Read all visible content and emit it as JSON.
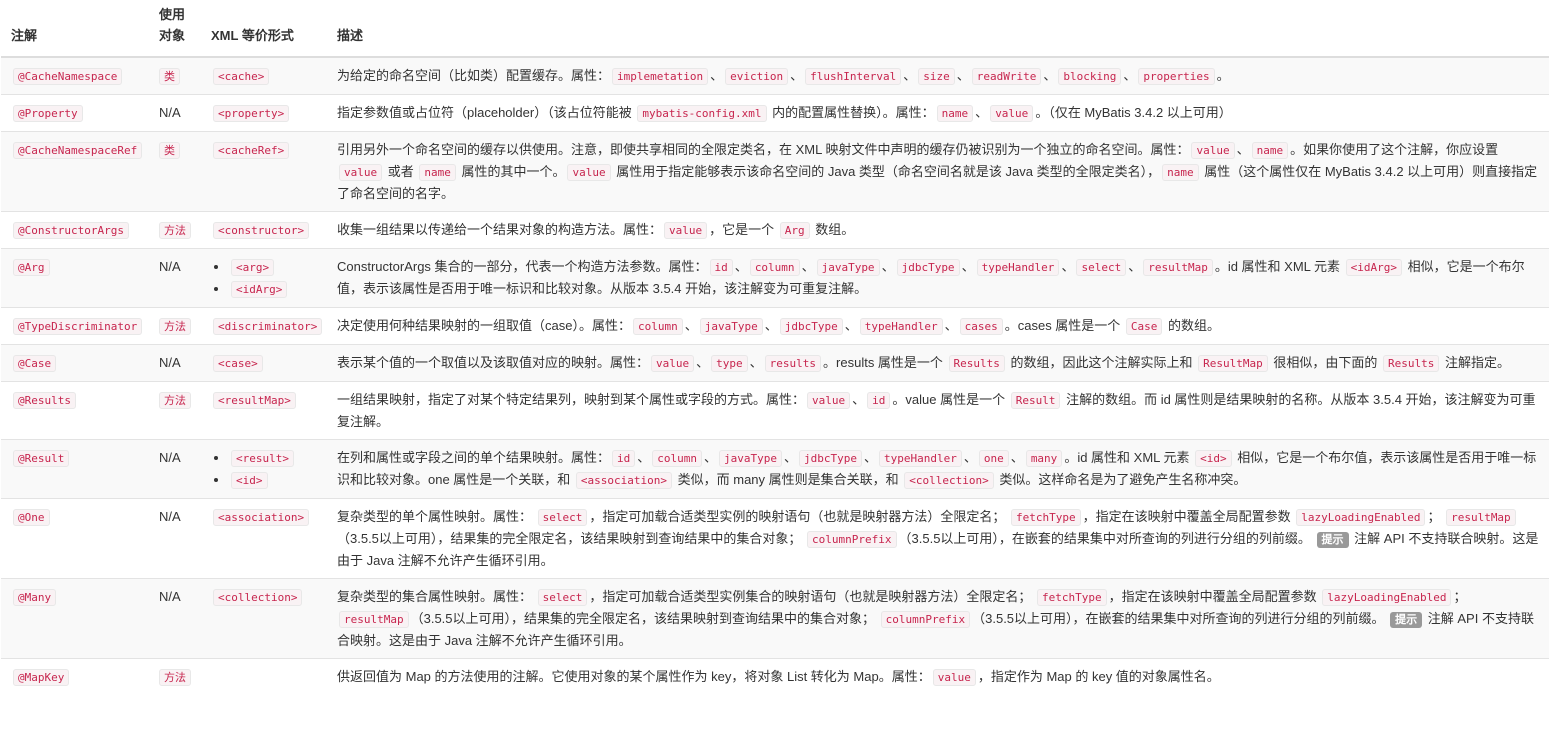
{
  "header": {
    "annotation": "注解",
    "target": "使用\n对象",
    "xml": "XML 等价形式",
    "desc": "描述"
  },
  "rows": [
    {
      "annotation": "@CacheNamespace",
      "target": "类",
      "target_code": true,
      "xml": [
        "<cache>"
      ],
      "desc": [
        [
          "t",
          "为给定的命名空间（比如类）配置缓存。属性："
        ],
        [
          "c",
          "implemetation"
        ],
        [
          "t",
          "、"
        ],
        [
          "c",
          "eviction"
        ],
        [
          "t",
          "、"
        ],
        [
          "c",
          "flushInterval"
        ],
        [
          "t",
          "、"
        ],
        [
          "c",
          "size"
        ],
        [
          "t",
          "、"
        ],
        [
          "c",
          "readWrite"
        ],
        [
          "t",
          "、"
        ],
        [
          "c",
          "blocking"
        ],
        [
          "t",
          "、"
        ],
        [
          "c",
          "properties"
        ],
        [
          "t",
          "。"
        ]
      ]
    },
    {
      "annotation": "@Property",
      "target": "N/A",
      "target_code": false,
      "xml": [
        "<property>"
      ],
      "desc": [
        [
          "t",
          "指定参数值或占位符（placeholder）（该占位符能被 "
        ],
        [
          "c",
          "mybatis-config.xml"
        ],
        [
          "t",
          " 内的配置属性替换）。属性："
        ],
        [
          "c",
          "name"
        ],
        [
          "t",
          "、"
        ],
        [
          "c",
          "value"
        ],
        [
          "t",
          "。（仅在 MyBatis 3.4.2 以上可用）"
        ]
      ]
    },
    {
      "annotation": "@CacheNamespaceRef",
      "target": "类",
      "target_code": true,
      "xml": [
        "<cacheRef>"
      ],
      "desc": [
        [
          "t",
          "引用另外一个命名空间的缓存以供使用。注意，即使共享相同的全限定类名，在 XML 映射文件中声明的缓存仍被识别为一个独立的命名空间。属性："
        ],
        [
          "c",
          "value"
        ],
        [
          "t",
          "、"
        ],
        [
          "c",
          "name"
        ],
        [
          "t",
          "。如果你使用了这个注解，你应设置 "
        ],
        [
          "c",
          "value"
        ],
        [
          "t",
          " 或者 "
        ],
        [
          "c",
          "name"
        ],
        [
          "t",
          " 属性的其中一个。"
        ],
        [
          "c",
          "value"
        ],
        [
          "t",
          " 属性用于指定能够表示该命名空间的 Java 类型（命名空间名就是该 Java 类型的全限定类名），"
        ],
        [
          "c",
          "name"
        ],
        [
          "t",
          " 属性（这个属性仅在 MyBatis 3.4.2 以上可用）则直接指定了命名空间的名字。"
        ]
      ]
    },
    {
      "annotation": "@ConstructorArgs",
      "target": "方法",
      "target_code": true,
      "xml": [
        "<constructor>"
      ],
      "desc": [
        [
          "t",
          "收集一组结果以传递给一个结果对象的构造方法。属性："
        ],
        [
          "c",
          "value"
        ],
        [
          "t",
          "，它是一个 "
        ],
        [
          "c",
          "Arg"
        ],
        [
          "t",
          " 数组。"
        ]
      ]
    },
    {
      "annotation": "@Arg",
      "target": "N/A",
      "target_code": false,
      "xml_list": true,
      "xml": [
        "<arg>",
        "<idArg>"
      ],
      "desc": [
        [
          "t",
          "ConstructorArgs 集合的一部分，代表一个构造方法参数。属性："
        ],
        [
          "c",
          "id"
        ],
        [
          "t",
          "、"
        ],
        [
          "c",
          "column"
        ],
        [
          "t",
          "、"
        ],
        [
          "c",
          "javaType"
        ],
        [
          "t",
          "、"
        ],
        [
          "c",
          "jdbcType"
        ],
        [
          "t",
          "、"
        ],
        [
          "c",
          "typeHandler"
        ],
        [
          "t",
          "、"
        ],
        [
          "c",
          "select"
        ],
        [
          "t",
          "、"
        ],
        [
          "c",
          "resultMap"
        ],
        [
          "t",
          "。id 属性和 XML 元素 "
        ],
        [
          "c",
          "<idArg>"
        ],
        [
          "t",
          " 相似，它是一个布尔值，表示该属性是否用于唯一标识和比较对象。从版本 3.5.4 开始，该注解变为可重复注解。"
        ]
      ]
    },
    {
      "annotation": "@TypeDiscriminator",
      "target": "方法",
      "target_code": true,
      "xml": [
        "<discriminator>"
      ],
      "desc": [
        [
          "t",
          "决定使用何种结果映射的一组取值（case）。属性："
        ],
        [
          "c",
          "column"
        ],
        [
          "t",
          "、"
        ],
        [
          "c",
          "javaType"
        ],
        [
          "t",
          "、"
        ],
        [
          "c",
          "jdbcType"
        ],
        [
          "t",
          "、"
        ],
        [
          "c",
          "typeHandler"
        ],
        [
          "t",
          "、"
        ],
        [
          "c",
          "cases"
        ],
        [
          "t",
          "。cases 属性是一个 "
        ],
        [
          "c",
          "Case"
        ],
        [
          "t",
          " 的数组。"
        ]
      ]
    },
    {
      "annotation": "@Case",
      "target": "N/A",
      "target_code": false,
      "xml": [
        "<case>"
      ],
      "desc": [
        [
          "t",
          "表示某个值的一个取值以及该取值对应的映射。属性："
        ],
        [
          "c",
          "value"
        ],
        [
          "t",
          "、"
        ],
        [
          "c",
          "type"
        ],
        [
          "t",
          "、"
        ],
        [
          "c",
          "results"
        ],
        [
          "t",
          "。results 属性是一个 "
        ],
        [
          "c",
          "Results"
        ],
        [
          "t",
          " 的数组，因此这个注解实际上和 "
        ],
        [
          "c",
          "ResultMap"
        ],
        [
          "t",
          " 很相似，由下面的 "
        ],
        [
          "c",
          "Results"
        ],
        [
          "t",
          " 注解指定。"
        ]
      ]
    },
    {
      "annotation": "@Results",
      "target": "方法",
      "target_code": true,
      "xml": [
        "<resultMap>"
      ],
      "desc": [
        [
          "t",
          "一组结果映射，指定了对某个特定结果列，映射到某个属性或字段的方式。属性："
        ],
        [
          "c",
          "value"
        ],
        [
          "t",
          "、"
        ],
        [
          "c",
          "id"
        ],
        [
          "t",
          "。value 属性是一个 "
        ],
        [
          "c",
          "Result"
        ],
        [
          "t",
          " 注解的数组。而 id 属性则是结果映射的名称。从版本 3.5.4 开始，该注解变为可重复注解。"
        ]
      ]
    },
    {
      "annotation": "@Result",
      "target": "N/A",
      "target_code": false,
      "xml_list": true,
      "xml": [
        "<result>",
        "<id>"
      ],
      "desc": [
        [
          "t",
          "在列和属性或字段之间的单个结果映射。属性："
        ],
        [
          "c",
          "id"
        ],
        [
          "t",
          "、"
        ],
        [
          "c",
          "column"
        ],
        [
          "t",
          "、"
        ],
        [
          "c",
          "javaType"
        ],
        [
          "t",
          "、"
        ],
        [
          "c",
          "jdbcType"
        ],
        [
          "t",
          "、"
        ],
        [
          "c",
          "typeHandler"
        ],
        [
          "t",
          "、"
        ],
        [
          "c",
          "one"
        ],
        [
          "t",
          "、"
        ],
        [
          "c",
          "many"
        ],
        [
          "t",
          "。id 属性和 XML 元素 "
        ],
        [
          "c",
          "<id>"
        ],
        [
          "t",
          " 相似，它是一个布尔值，表示该属性是否用于唯一标识和比较对象。one 属性是一个关联，和 "
        ],
        [
          "c",
          "<association>"
        ],
        [
          "t",
          " 类似，而 many 属性则是集合关联，和 "
        ],
        [
          "c",
          "<collection>"
        ],
        [
          "t",
          " 类似。这样命名是为了避免产生名称冲突。"
        ]
      ]
    },
    {
      "annotation": "@One",
      "target": "N/A",
      "target_code": false,
      "xml": [
        "<association>"
      ],
      "desc": [
        [
          "t",
          "复杂类型的单个属性映射。属性： "
        ],
        [
          "c",
          "select"
        ],
        [
          "t",
          "，指定可加载合适类型实例的映射语句（也就是映射器方法）全限定名； "
        ],
        [
          "c",
          "fetchType"
        ],
        [
          "t",
          "，指定在该映射中覆盖全局配置参数 "
        ],
        [
          "c",
          "lazyLoadingEnabled"
        ],
        [
          "t",
          "； "
        ],
        [
          "c",
          "resultMap"
        ],
        [
          "t",
          "（3.5.5以上可用），结果集的完全限定名，该结果映射到查询结果中的集合对象； "
        ],
        [
          "c",
          "columnPrefix"
        ],
        [
          "t",
          "（3.5.5以上可用），在嵌套的结果集中对所查询的列进行分组的列前缀。 "
        ],
        [
          "b",
          "提示"
        ],
        [
          "t",
          " 注解 API 不支持联合映射。这是由于 Java 注解不允许产生循环引用。"
        ]
      ]
    },
    {
      "annotation": "@Many",
      "target": "N/A",
      "target_code": false,
      "xml": [
        "<collection>"
      ],
      "desc": [
        [
          "t",
          "复杂类型的集合属性映射。属性： "
        ],
        [
          "c",
          "select"
        ],
        [
          "t",
          "，指定可加载合适类型实例集合的映射语句（也就是映射器方法）全限定名； "
        ],
        [
          "c",
          "fetchType"
        ],
        [
          "t",
          "，指定在该映射中覆盖全局配置参数 "
        ],
        [
          "c",
          "lazyLoadingEnabled"
        ],
        [
          "t",
          "； "
        ],
        [
          "c",
          "resultMap"
        ],
        [
          "t",
          "（3.5.5以上可用），结果集的完全限定名，该结果映射到查询结果中的集合对象； "
        ],
        [
          "c",
          "columnPrefix"
        ],
        [
          "t",
          "（3.5.5以上可用），在嵌套的结果集中对所查询的列进行分组的列前缀。 "
        ],
        [
          "b",
          "提示"
        ],
        [
          "t",
          " 注解 API 不支持联合映射。这是由于 Java 注解不允许产生循环引用。"
        ]
      ]
    },
    {
      "annotation": "@MapKey",
      "target": "方法",
      "target_code": true,
      "xml": [],
      "desc": [
        [
          "t",
          "供返回值为 Map 的方法使用的注解。它使用对象的某个属性作为 key，将对象 List 转化为 Map。属性："
        ],
        [
          "c",
          "value"
        ],
        [
          "t",
          "，指定作为 Map 的 key 值的对象属性名。"
        ]
      ]
    }
  ]
}
